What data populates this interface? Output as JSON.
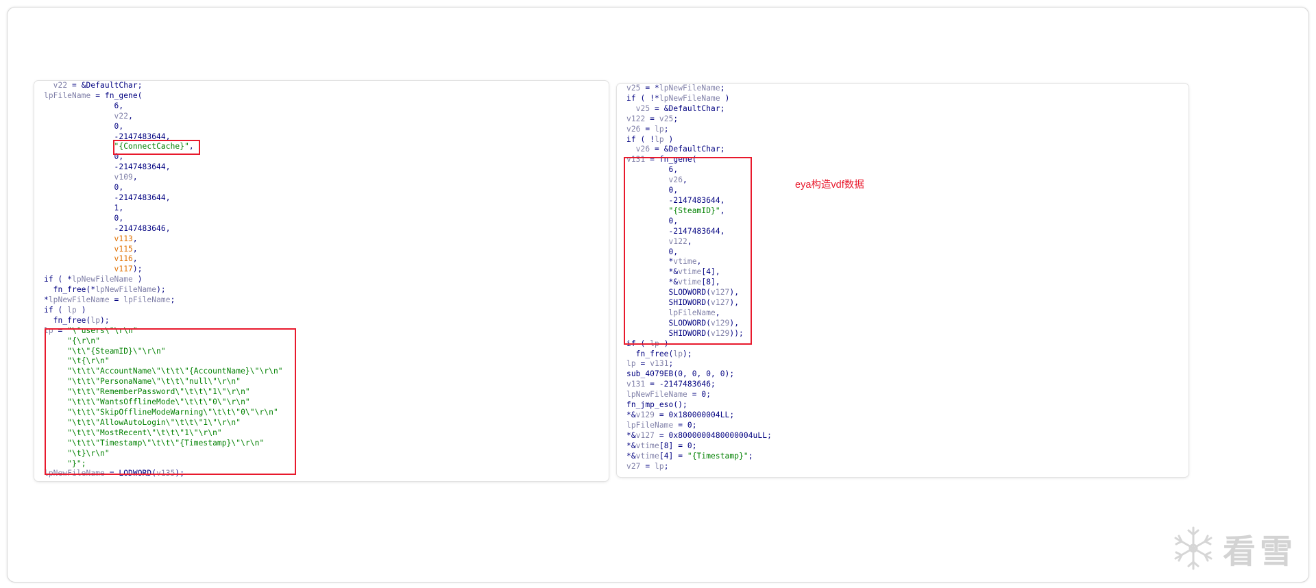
{
  "left_panel": {
    "lines": [
      [
        {
          "t": "  "
        },
        {
          "t": "v22",
          "c": "var"
        },
        {
          "t": " = &DefaultChar;"
        }
      ],
      [
        {
          "t": "lpFileName",
          "c": "var"
        },
        {
          "t": " = fn_gene("
        }
      ],
      [
        {
          "t": "               6,"
        }
      ],
      [
        {
          "t": "               "
        },
        {
          "t": "v22",
          "c": "var"
        },
        {
          "t": ","
        }
      ],
      [
        {
          "t": "               0,"
        }
      ],
      [
        {
          "t": "               -2147483644,"
        }
      ],
      [
        {
          "t": "               "
        },
        {
          "t": "\"{ConnectCache}\"",
          "c": "str"
        },
        {
          "t": ","
        }
      ],
      [
        {
          "t": "               0,"
        }
      ],
      [
        {
          "t": "               -2147483644,"
        }
      ],
      [
        {
          "t": "               "
        },
        {
          "t": "v109",
          "c": "var"
        },
        {
          "t": ","
        }
      ],
      [
        {
          "t": "               0,"
        }
      ],
      [
        {
          "t": "               -2147483644,"
        }
      ],
      [
        {
          "t": "               1,"
        }
      ],
      [
        {
          "t": "               0,"
        }
      ],
      [
        {
          "t": "               -2147483646,"
        }
      ],
      [
        {
          "t": "               "
        },
        {
          "t": "v113",
          "c": "org"
        },
        {
          "t": ","
        }
      ],
      [
        {
          "t": "               "
        },
        {
          "t": "v115",
          "c": "org"
        },
        {
          "t": ","
        }
      ],
      [
        {
          "t": "               "
        },
        {
          "t": "v116",
          "c": "org"
        },
        {
          "t": ","
        }
      ],
      [
        {
          "t": "               "
        },
        {
          "t": "v117",
          "c": "org"
        },
        {
          "t": ");"
        }
      ],
      [
        {
          "t": "if ( *"
        },
        {
          "t": "lpNewFileName",
          "c": "var"
        },
        {
          "t": " )"
        }
      ],
      [
        {
          "t": "  fn_free(*"
        },
        {
          "t": "lpNewFileName",
          "c": "var"
        },
        {
          "t": ");"
        }
      ],
      [
        {
          "t": "*"
        },
        {
          "t": "lpNewFileName",
          "c": "var"
        },
        {
          "t": " = "
        },
        {
          "t": "lpFileName",
          "c": "var"
        },
        {
          "t": ";"
        }
      ],
      [
        {
          "t": "if ( "
        },
        {
          "t": "lp",
          "c": "var"
        },
        {
          "t": " )"
        }
      ],
      [
        {
          "t": "  fn_free("
        },
        {
          "t": "lp",
          "c": "var"
        },
        {
          "t": ");"
        }
      ],
      [
        {
          "t": "lp",
          "c": "var"
        },
        {
          "t": " = "
        },
        {
          "t": "\"\\\"users\\\"\\r\\n\"",
          "c": "str"
        }
      ],
      [
        {
          "t": "     "
        },
        {
          "t": "\"{\\r\\n\"",
          "c": "str"
        }
      ],
      [
        {
          "t": "     "
        },
        {
          "t": "\"\\t\\\"{SteamID}\\\"\\r\\n\"",
          "c": "str"
        }
      ],
      [
        {
          "t": "     "
        },
        {
          "t": "\"\\t{\\r\\n\"",
          "c": "str"
        }
      ],
      [
        {
          "t": "     "
        },
        {
          "t": "\"\\t\\t\\\"AccountName\\\"\\t\\t\\\"{AccountName}\\\"\\r\\n\"",
          "c": "str"
        }
      ],
      [
        {
          "t": "     "
        },
        {
          "t": "\"\\t\\t\\\"PersonaName\\\"\\t\\t\\\"null\\\"\\r\\n\"",
          "c": "str"
        }
      ],
      [
        {
          "t": "     "
        },
        {
          "t": "\"\\t\\t\\\"RememberPassword\\\"\\t\\t\\\"1\\\"\\r\\n\"",
          "c": "str"
        }
      ],
      [
        {
          "t": "     "
        },
        {
          "t": "\"\\t\\t\\\"WantsOfflineMode\\\"\\t\\t\\\"0\\\"\\r\\n\"",
          "c": "str"
        }
      ],
      [
        {
          "t": "     "
        },
        {
          "t": "\"\\t\\t\\\"SkipOfflineModeWarning\\\"\\t\\t\\\"0\\\"\\r\\n\"",
          "c": "str"
        }
      ],
      [
        {
          "t": "     "
        },
        {
          "t": "\"\\t\\t\\\"AllowAutoLogin\\\"\\t\\t\\\"1\\\"\\r\\n\"",
          "c": "str"
        }
      ],
      [
        {
          "t": "     "
        },
        {
          "t": "\"\\t\\t\\\"MostRecent\\\"\\t\\t\\\"1\\\"\\r\\n\"",
          "c": "str"
        }
      ],
      [
        {
          "t": "     "
        },
        {
          "t": "\"\\t\\t\\\"Timestamp\\\"\\t\\t\\\"{Timestamp}\\\"\\r\\n\"",
          "c": "str"
        }
      ],
      [
        {
          "t": "     "
        },
        {
          "t": "\"\\t}\\r\\n\"",
          "c": "str"
        }
      ],
      [
        {
          "t": "     "
        },
        {
          "t": "\"}\";",
          "c": "str"
        }
      ],
      [
        {
          "t": "lpNewFileName",
          "c": "var"
        },
        {
          "t": " = LODWORD("
        },
        {
          "t": "v135",
          "c": "var"
        },
        {
          "t": ");"
        }
      ]
    ]
  },
  "right_panel": {
    "lines": [
      [
        {
          "t": "v25",
          "c": "var"
        },
        {
          "t": " = *"
        },
        {
          "t": "lpNewFileName",
          "c": "var"
        },
        {
          "t": ";"
        }
      ],
      [
        {
          "t": "if ( !*"
        },
        {
          "t": "lpNewFileName",
          "c": "var"
        },
        {
          "t": " )"
        }
      ],
      [
        {
          "t": "  "
        },
        {
          "t": "v25",
          "c": "var"
        },
        {
          "t": " = &DefaultChar;"
        }
      ],
      [
        {
          "t": "v122",
          "c": "var"
        },
        {
          "t": " = "
        },
        {
          "t": "v25",
          "c": "var"
        },
        {
          "t": ";"
        }
      ],
      [
        {
          "t": "v26",
          "c": "var"
        },
        {
          "t": " = "
        },
        {
          "t": "lp",
          "c": "var"
        },
        {
          "t": ";"
        }
      ],
      [
        {
          "t": "if ( !"
        },
        {
          "t": "lp",
          "c": "var"
        },
        {
          "t": " )"
        }
      ],
      [
        {
          "t": "  "
        },
        {
          "t": "v26",
          "c": "var"
        },
        {
          "t": " = &DefaultChar;"
        }
      ],
      [
        {
          "t": "v131",
          "c": "var"
        },
        {
          "t": " = fn_gene("
        }
      ],
      [
        {
          "t": "         6,"
        }
      ],
      [
        {
          "t": "         "
        },
        {
          "t": "v26",
          "c": "var"
        },
        {
          "t": ","
        }
      ],
      [
        {
          "t": "         0,"
        }
      ],
      [
        {
          "t": "         -2147483644,"
        }
      ],
      [
        {
          "t": "         "
        },
        {
          "t": "\"{SteamID}\"",
          "c": "str"
        },
        {
          "t": ","
        }
      ],
      [
        {
          "t": "         0,"
        }
      ],
      [
        {
          "t": "         -2147483644,"
        }
      ],
      [
        {
          "t": "         "
        },
        {
          "t": "v122",
          "c": "var"
        },
        {
          "t": ","
        }
      ],
      [
        {
          "t": "         0,"
        }
      ],
      [
        {
          "t": "         *"
        },
        {
          "t": "vtime",
          "c": "var"
        },
        {
          "t": ","
        }
      ],
      [
        {
          "t": "         *&"
        },
        {
          "t": "vtime",
          "c": "var"
        },
        {
          "t": "[4],"
        }
      ],
      [
        {
          "t": "         *&"
        },
        {
          "t": "vtime",
          "c": "var"
        },
        {
          "t": "[8],"
        }
      ],
      [
        {
          "t": "         SLODWORD("
        },
        {
          "t": "v127",
          "c": "var"
        },
        {
          "t": "),"
        }
      ],
      [
        {
          "t": "         SHIDWORD("
        },
        {
          "t": "v127",
          "c": "var"
        },
        {
          "t": "),"
        }
      ],
      [
        {
          "t": "         "
        },
        {
          "t": "lpFileName",
          "c": "var"
        },
        {
          "t": ","
        }
      ],
      [
        {
          "t": "         SLODWORD("
        },
        {
          "t": "v129",
          "c": "var"
        },
        {
          "t": "),"
        }
      ],
      [
        {
          "t": "         SHIDWORD("
        },
        {
          "t": "v129",
          "c": "var"
        },
        {
          "t": "));"
        }
      ],
      [
        {
          "t": "if ( "
        },
        {
          "t": "lp",
          "c": "var"
        },
        {
          "t": " )"
        }
      ],
      [
        {
          "t": "  fn_free("
        },
        {
          "t": "lp",
          "c": "var"
        },
        {
          "t": ");"
        }
      ],
      [
        {
          "t": "lp",
          "c": "var"
        },
        {
          "t": " = "
        },
        {
          "t": "v131",
          "c": "var"
        },
        {
          "t": ";"
        }
      ],
      [
        {
          "t": "sub_4079EB(0, 0, 0, 0);"
        }
      ],
      [
        {
          "t": "v131",
          "c": "var"
        },
        {
          "t": " = -2147483646;"
        }
      ],
      [
        {
          "t": "lpNewFileName",
          "c": "var"
        },
        {
          "t": " = 0;"
        }
      ],
      [
        {
          "t": "fn_jmp_eso();"
        }
      ],
      [
        {
          "t": "*&"
        },
        {
          "t": "v129",
          "c": "var"
        },
        {
          "t": " = 0x180000004LL;"
        }
      ],
      [
        {
          "t": "lpFileName",
          "c": "var"
        },
        {
          "t": " = 0;"
        }
      ],
      [
        {
          "t": "*&"
        },
        {
          "t": "v127",
          "c": "var"
        },
        {
          "t": " = 0x8000000480000004uLL;"
        }
      ],
      [
        {
          "t": "*&"
        },
        {
          "t": "vtime",
          "c": "var"
        },
        {
          "t": "[8] = 0;"
        }
      ],
      [
        {
          "t": "*&"
        },
        {
          "t": "vtime",
          "c": "var"
        },
        {
          "t": "[4] = "
        },
        {
          "t": "\"{Timestamp}\"",
          "c": "str"
        },
        {
          "t": ";"
        }
      ],
      [
        {
          "t": "v27",
          "c": "var"
        },
        {
          "t": " = "
        },
        {
          "t": "lp",
          "c": "var"
        },
        {
          "t": ";"
        }
      ]
    ]
  },
  "annotation": {
    "text": "eya构造vdf数据"
  },
  "watermark": {
    "text": "看雪",
    "icon": "snowflake-icon"
  },
  "colors": {
    "variable": "#8080a8",
    "keyword": "#000080",
    "string": "#008000",
    "orange_var": "#e07000",
    "highlight_box": "#e8192c",
    "annotation": "#e8192c",
    "watermark": "#d3d3d3"
  }
}
